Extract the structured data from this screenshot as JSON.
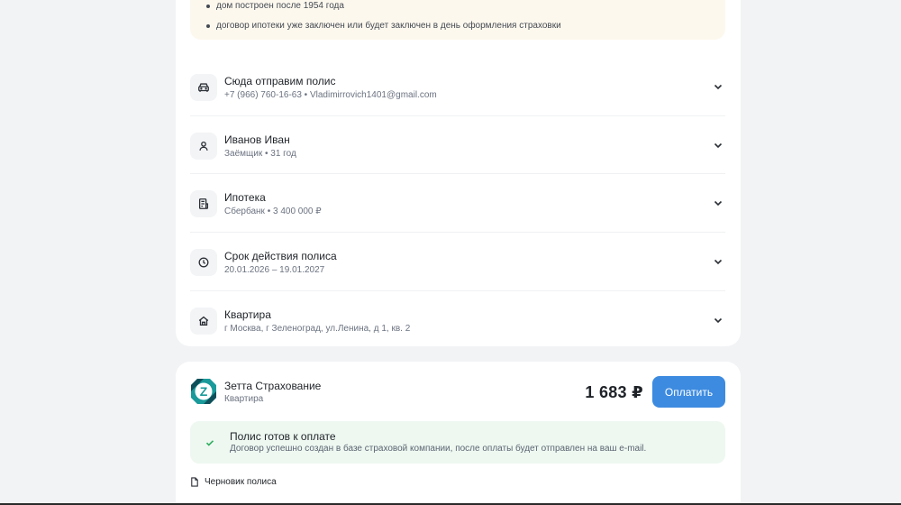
{
  "notice": {
    "items": [
      "дом построен после 1954 года",
      "договор ипотеки уже заключен или будет заключен в день оформления страховки"
    ]
  },
  "sections": [
    {
      "title": "Сюда отправим полис",
      "subtitle": "+7 (966) 760-16-63 • Vladimirrovich1401@gmail.com",
      "icon": "car-icon"
    },
    {
      "title": "Иванов Иван",
      "subtitle": "Заёмщик • 31 год",
      "icon": "user-icon"
    },
    {
      "title": "Ипотека",
      "subtitle": "Сбербанк • 3 400 000 ₽",
      "icon": "document-icon"
    },
    {
      "title": "Срок действия полиса",
      "subtitle": "20.01.2026 – 19.01.2027",
      "icon": "clock-icon"
    },
    {
      "title": "Квартира",
      "subtitle": "г Москва, г Зеленоград, ул.Ленина, д 1, кв. 2",
      "icon": "home-icon"
    }
  ],
  "offer": {
    "company_name": "Зетта Страхование",
    "company_type": "Квартира",
    "logo_letter": "Z",
    "price": "1 683 ₽",
    "pay_label": "Оплатить"
  },
  "status": {
    "title": "Полис готов к оплате",
    "text": "Договор успешно создан в базе страховой компании, после оплаты будет отправлен на ваш e-mail."
  },
  "draft_label": "Черновик полиса",
  "colors": {
    "accent": "#3d8be0",
    "notice_bg": "#fdf8ee",
    "success_bg": "#eef8f1",
    "success_check": "#2fae5e",
    "logo_teal": "#1a9a9a"
  }
}
